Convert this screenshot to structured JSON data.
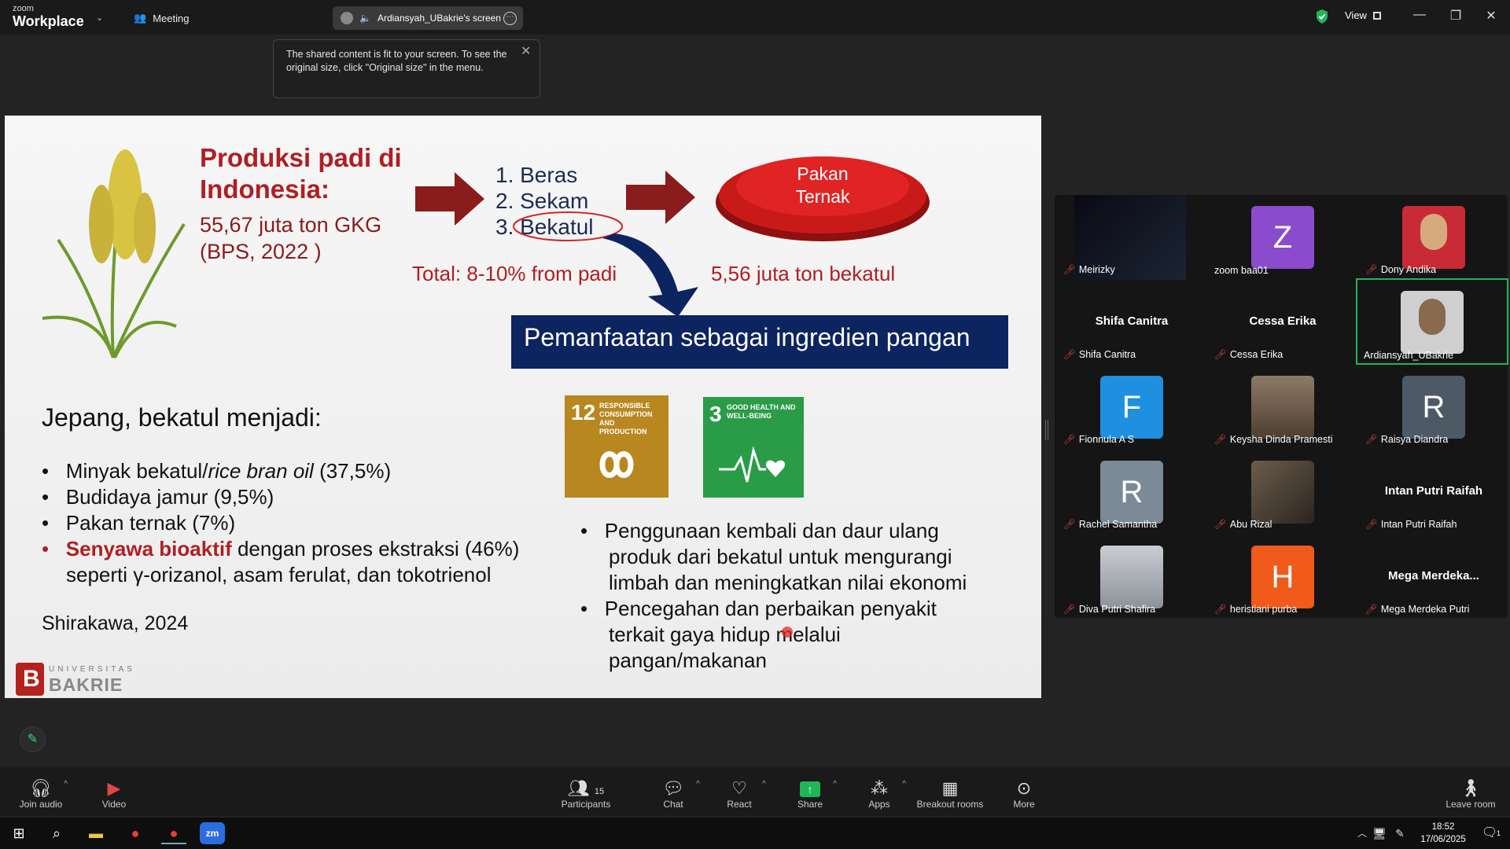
{
  "app": {
    "logo_line1": "zoom",
    "logo_line2": "Workplace",
    "meeting_label": "Meeting",
    "share_label": "Ardiansyah_UBakrie's screen",
    "view_label": "View"
  },
  "tooltip": {
    "text": "The shared content is fit to your screen. To see the original size, click \"Original size\" in the menu."
  },
  "slide": {
    "title": "Produksi padi di Indonesia:",
    "stat_line1": "55,67 juta ton GKG",
    "stat_line2": "(BPS, 2022 )",
    "list": [
      "1.  Beras",
      "2.  Sekam",
      "3.  Bekatul"
    ],
    "pakan": "Pakan Ternak",
    "total": "Total:  8-10% from padi",
    "bekatul_amount": "5,56 juta ton bekatul",
    "banner": "Pemanfaatan sebagai ingredien pangan",
    "jepang_heading": "Jepang, bekatul menjadi:",
    "bullet1a": "Minyak bekatul/",
    "bullet1b": "rice bran oil",
    "bullet1c": " (37,5%)",
    "bullet2": "Budidaya jamur (9,5%)",
    "bullet3": "Pakan ternak (7%)",
    "bullet4a": "Senyawa bioaktif",
    "bullet4b": " dengan proses ekstraksi (46%)",
    "bullet4c": "seperti γ-orizanol, asam ferulat, dan tokotrienol",
    "source": "Shirakawa, 2024",
    "sdg12": {
      "number": "12",
      "text": "RESPONSIBLE CONSUMPTION AND PRODUCTION"
    },
    "sdg3": {
      "number": "3",
      "text": "GOOD HEALTH AND WELL-BEING"
    },
    "right_bullet1": [
      "Penggunaan kembali dan daur ulang",
      "produk dari bekatul untuk mengurangi",
      "limbah dan meningkatkan nilai ekonomi"
    ],
    "right_bullet2": [
      "Pencegahan dan perbaikan penyakit",
      "terkait gaya hidup melalui",
      "pangan/makanan"
    ],
    "ub_logo_top": "UNIVERSITAS",
    "ub_logo_bottom": "BAKRIE",
    "ub_letter": "B"
  },
  "participants": [
    {
      "name": "Meirizky",
      "avatar": ""
    },
    {
      "name": "zoom baa01",
      "avatar": "Z"
    },
    {
      "name": "Dony Andika",
      "avatar": ""
    },
    {
      "name": "Shifa Canitra",
      "display": "Shifa Canitra"
    },
    {
      "name": "Cessa Erika",
      "display": "Cessa Erika"
    },
    {
      "name": "Ardiansyah_UBakrie",
      "avatar": ""
    },
    {
      "name": "Fionnula A S",
      "avatar": "F"
    },
    {
      "name": "Keysha Dinda Pramesti",
      "avatar": ""
    },
    {
      "name": "Raisya Diandra",
      "avatar": "R"
    },
    {
      "name": "Rachel Samantha",
      "avatar": "R"
    },
    {
      "name": "Abu Rizal",
      "avatar": ""
    },
    {
      "name": "Intan Putri Raifah",
      "display": "Intan Putri Raifah"
    },
    {
      "name": "Diva Putri Shafira",
      "avatar": ""
    },
    {
      "name": "heristiani purba",
      "avatar": "H"
    },
    {
      "name": "Mega Merdeka Putri",
      "display": "Mega  Merdeka..."
    }
  ],
  "toolbar": {
    "join_audio": "Join audio",
    "video": "Video",
    "participants": "Participants",
    "participants_count": "15",
    "chat": "Chat",
    "react": "React",
    "share": "Share",
    "apps": "Apps",
    "breakout": "Breakout rooms",
    "more": "More",
    "leave": "Leave room"
  },
  "taskbar": {
    "time": "18:52",
    "date": "17/06/2025",
    "notif_count": "1"
  },
  "colors": {
    "accent_green": "#21b559",
    "slide_red": "#b01e23",
    "banner_blue": "#0c2460"
  }
}
